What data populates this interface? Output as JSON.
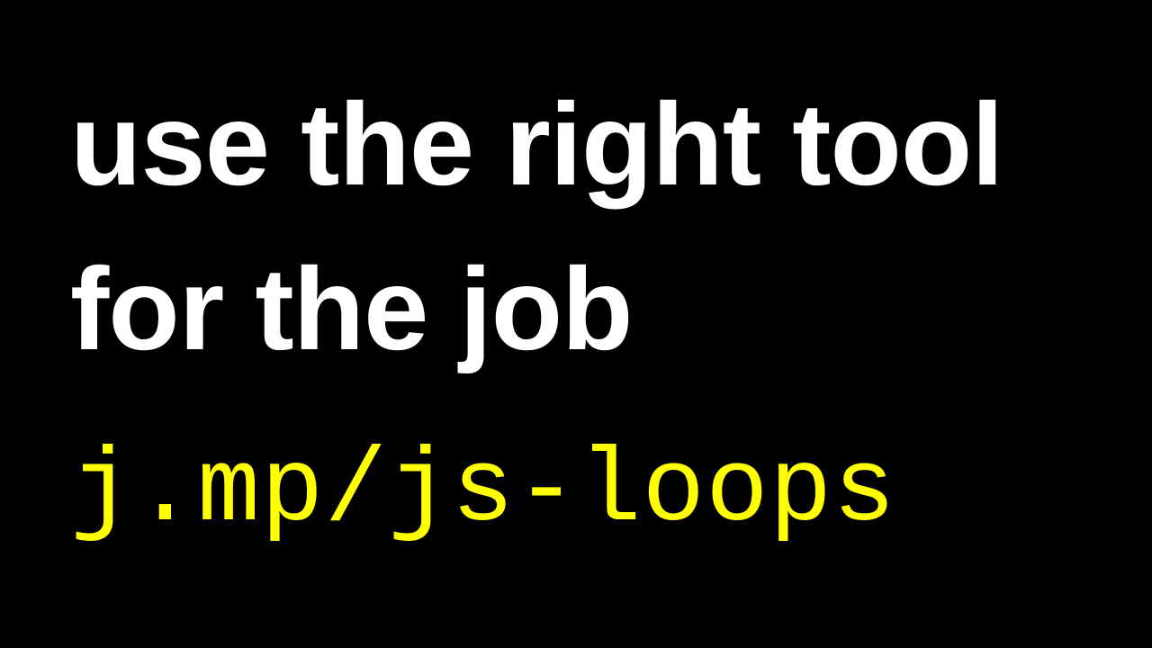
{
  "slide": {
    "line1": "use the right tool",
    "line2": "for the job",
    "link": "j.mp/js-loops"
  },
  "colors": {
    "background": "#000000",
    "headline": "#ffffff",
    "link": "#ffff00"
  }
}
